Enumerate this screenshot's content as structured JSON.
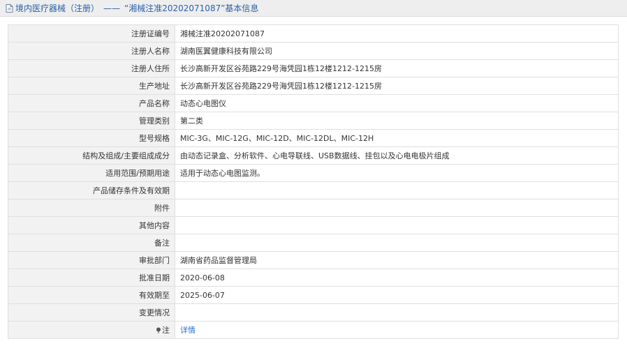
{
  "header": {
    "breadcrumb": "境内医疗器械（注册）",
    "separator": "——",
    "title": "“湘械注准20202071087”基本信息"
  },
  "rows": [
    {
      "label": "注册证编号",
      "value": "湘械注准20202071087"
    },
    {
      "label": "注册人名称",
      "value": "湖南医翼健康科技有限公司"
    },
    {
      "label": "注册人住所",
      "value": "长沙高新开发区谷苑路229号海凭园1栋12楼1212-1215房"
    },
    {
      "label": "生产地址",
      "value": "长沙高新开发区谷苑路229号海凭园1栋12楼1212-1215房"
    },
    {
      "label": "产品名称",
      "value": "动态心电图仪"
    },
    {
      "label": "管理类别",
      "value": "第二类"
    },
    {
      "label": "型号规格",
      "value": "MIC-3G、MIC-12G、MIC-12D、MIC-12DL、MIC-12H"
    },
    {
      "label": "结构及组成/主要组成成分",
      "value": "由动态记录盒、分析软件、心电导联线、USB数据线、挂包以及心电电极片组成"
    },
    {
      "label": "适用范围/预期用途",
      "value": "适用于动态心电图监测。"
    },
    {
      "label": "产品储存条件及有效期",
      "value": ""
    },
    {
      "label": "附件",
      "value": ""
    },
    {
      "label": "其他内容",
      "value": ""
    },
    {
      "label": "备注",
      "value": ""
    },
    {
      "label": "审批部门",
      "value": "湖南省药品监督管理局"
    },
    {
      "label": "批准日期",
      "value": "2020-06-08"
    },
    {
      "label": "有效期至",
      "value": "2025-06-07"
    },
    {
      "label": "变更情况",
      "value": ""
    }
  ],
  "note_row": {
    "label": "注",
    "link_text": "详情",
    "icon": "pin-icon"
  },
  "colors": {
    "header_bg": "#eeeeee",
    "title_text": "#2a5fa8",
    "label_bg": "#f2f2f2",
    "link": "#2a6fc9",
    "border": "#dfdfdf"
  }
}
